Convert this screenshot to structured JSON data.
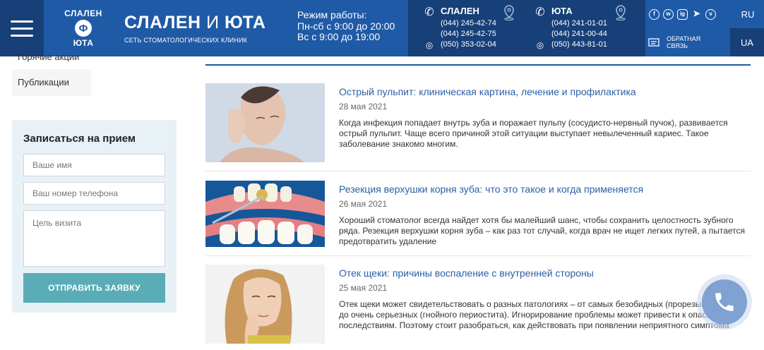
{
  "header": {
    "logo_top": "СЛАЛЕН",
    "logo_bottom": "ЮТА",
    "brand_name_1": "СЛАЛЕН",
    "brand_name_and": "И",
    "brand_name_2": "ЮТА",
    "brand_subtitle": "СЕТЬ СТОМАТОЛОГИЧЕСКИХ КЛИНИК",
    "hours_title": "Режим работы:",
    "hours_weekday": "Пн-сб с 9:00 до 20:00",
    "hours_sunday": "Вс с 9:00 до 19:00",
    "clinic1": {
      "name": "СЛАЛЕН",
      "phone1": "(044) 245-42-74",
      "phone2": "(044) 245-42-75",
      "phone3": "(050) 353-02-04"
    },
    "clinic2": {
      "name": "ЮТА",
      "phone1": "(044) 241-01-01",
      "phone2": "(044) 241-00-44",
      "phone3": "(050) 443-81-01"
    },
    "social": [
      "f",
      "w",
      "ig",
      "tg",
      "v"
    ],
    "lang_ru": "RU",
    "lang_ua": "UA",
    "feedback_1": "ОБРАТНАЯ",
    "feedback_2": "СВЯЗЬ"
  },
  "sidebar": {
    "menu_item_1": "Горячие акции",
    "menu_item_2": "Публикации"
  },
  "form": {
    "title": "Записаться на прием",
    "name_placeholder": "Ваше имя",
    "phone_placeholder": "Ваш номер телефона",
    "goal_placeholder": "Цель визита",
    "submit_label": "ОТПРАВИТЬ ЗАЯВКУ"
  },
  "articles": [
    {
      "title": "Острый пульпит: клиническая картина, лечение и профилактика",
      "date": "28 мая 2021",
      "excerpt": "Когда инфекция попадает внутрь зуба и поражает пульпу (сосудисто-нервный пучок), развивается острый пульпит. Чаще всего причиной этой ситуации выступает невылеченный кариес. Такое заболевание знакомо многим."
    },
    {
      "title": "Резекция верхушки корня зуба: что это такое и когда применяется",
      "date": "26 мая 2021",
      "excerpt": "Хороший стоматолог всегда найдет хотя бы малейший шанс, чтобы сохранить целостность зубного ряда. Резекция верхушки корня зуба – как раз тот случай, когда врач не ищет легких путей, а пытается предотвратить удаление"
    },
    {
      "title": "Отек щеки: причины воспаление с внутренней стороны",
      "date": "25 мая 2021",
      "excerpt": "Отек щеки может свидетельствовать о разных патологиях – от самых безобидных (прорезывание зуба) до очень серьезных (гнойного периостита). Игнорирование проблемы может привести к опасным последствиям. Поэтому стоит разобраться, как действовать при появлении неприятного симптома"
    }
  ]
}
